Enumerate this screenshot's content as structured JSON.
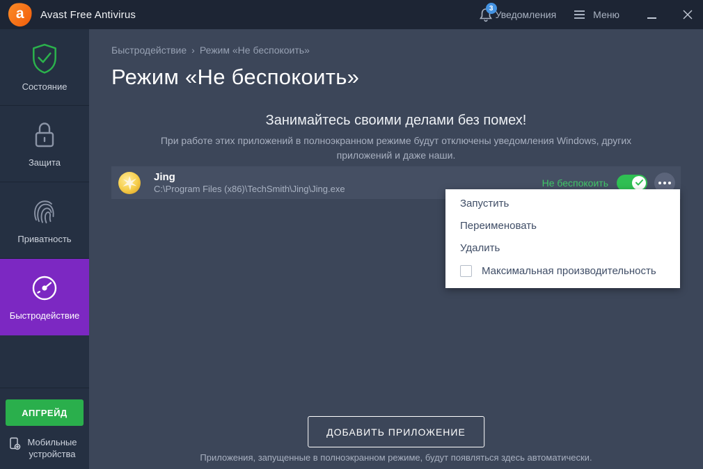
{
  "titlebar": {
    "app_title": "Avast Free Antivirus",
    "notifications": {
      "label": "Уведомления",
      "count": "3"
    },
    "menu_label": "Меню"
  },
  "sidebar": {
    "items": [
      {
        "label": "Состояние",
        "icon": "shield-check-icon",
        "active": false
      },
      {
        "label": "Защита",
        "icon": "lock-icon",
        "active": false
      },
      {
        "label": "Приватность",
        "icon": "fingerprint-icon",
        "active": false
      },
      {
        "label": "Быстродействие",
        "icon": "gauge-icon",
        "active": true
      }
    ],
    "upgrade_label": "АПГРЕЙД",
    "mobile_label": "Мобильные устройства"
  },
  "main": {
    "breadcrumb": {
      "section": "Быстродействие",
      "separator": "›",
      "page": "Режим «Не беспокоить»"
    },
    "page_title": "Режим «Не беспокоить»",
    "subtitle": "Занимайтесь своими делами без помех!",
    "description": "При работе этих приложений в полноэкранном режиме будут отключены уведомления Windows, других приложений и даже наши.",
    "app_row": {
      "name": "Jing",
      "path": "C:\\Program Files (x86)\\TechSmith\\Jing\\Jing.exe",
      "status_label": "Не беспокоить",
      "toggle_on": true
    },
    "context_menu": {
      "items": [
        "Запустить",
        "Переименовать",
        "Удалить"
      ],
      "checkbox_item": {
        "label": "Максимальная производительность",
        "checked": false
      }
    },
    "add_button_label": "ДОБАВИТЬ ПРИЛОЖЕНИЕ",
    "footer_note": "Приложения, запущенные в полноэкранном режиме, будут появляться здесь автоматически."
  },
  "colors": {
    "titlebar_bg": "#1d2534",
    "sidebar_bg": "#253042",
    "main_bg": "#3c4659",
    "row_bg": "#454f63",
    "active_purple": "#7c28c2",
    "accent_green": "#41c768",
    "toggle_green": "#2fbf53",
    "upgrade_green": "#2aaf4c",
    "badge_blue": "#4493e2",
    "logo_orange": "#f25c0a"
  }
}
